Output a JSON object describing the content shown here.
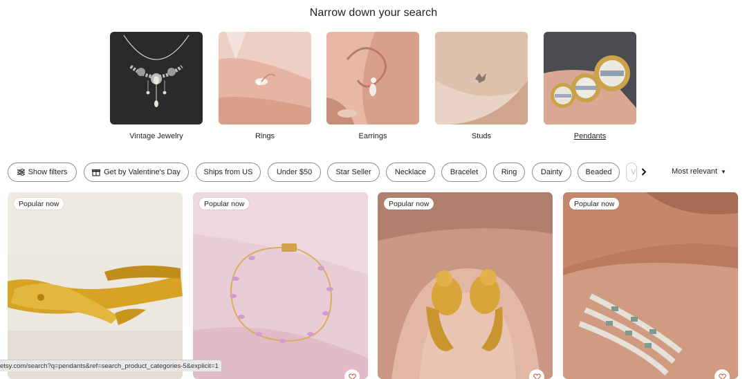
{
  "section": {
    "title": "Narrow down your search"
  },
  "categories": [
    {
      "label": "Vintage Jewelry",
      "active": false
    },
    {
      "label": "Rings",
      "active": false
    },
    {
      "label": "Earrings",
      "active": false
    },
    {
      "label": "Studs",
      "active": false
    },
    {
      "label": "Pendants",
      "active": true
    }
  ],
  "filters": {
    "show_filters": "Show filters",
    "valentines": "Get by Valentine's Day",
    "ships_from": "Ships from US",
    "under_50": "Under $50",
    "star_seller": "Star Seller",
    "necklace": "Necklace",
    "bracelet": "Bracelet",
    "ring": "Ring",
    "dainty": "Dainty",
    "beaded": "Beaded",
    "partial_chip": "V",
    "sort_label": "Most relevant"
  },
  "listings": [
    {
      "badge": "Popular now"
    },
    {
      "badge": "Popular now"
    },
    {
      "badge": "Popular now"
    },
    {
      "badge": "Popular now"
    }
  ],
  "status_bar": {
    "url": "etsy.com/search?q=pendants&ref=search_product_categories-5&explicit=1"
  }
}
